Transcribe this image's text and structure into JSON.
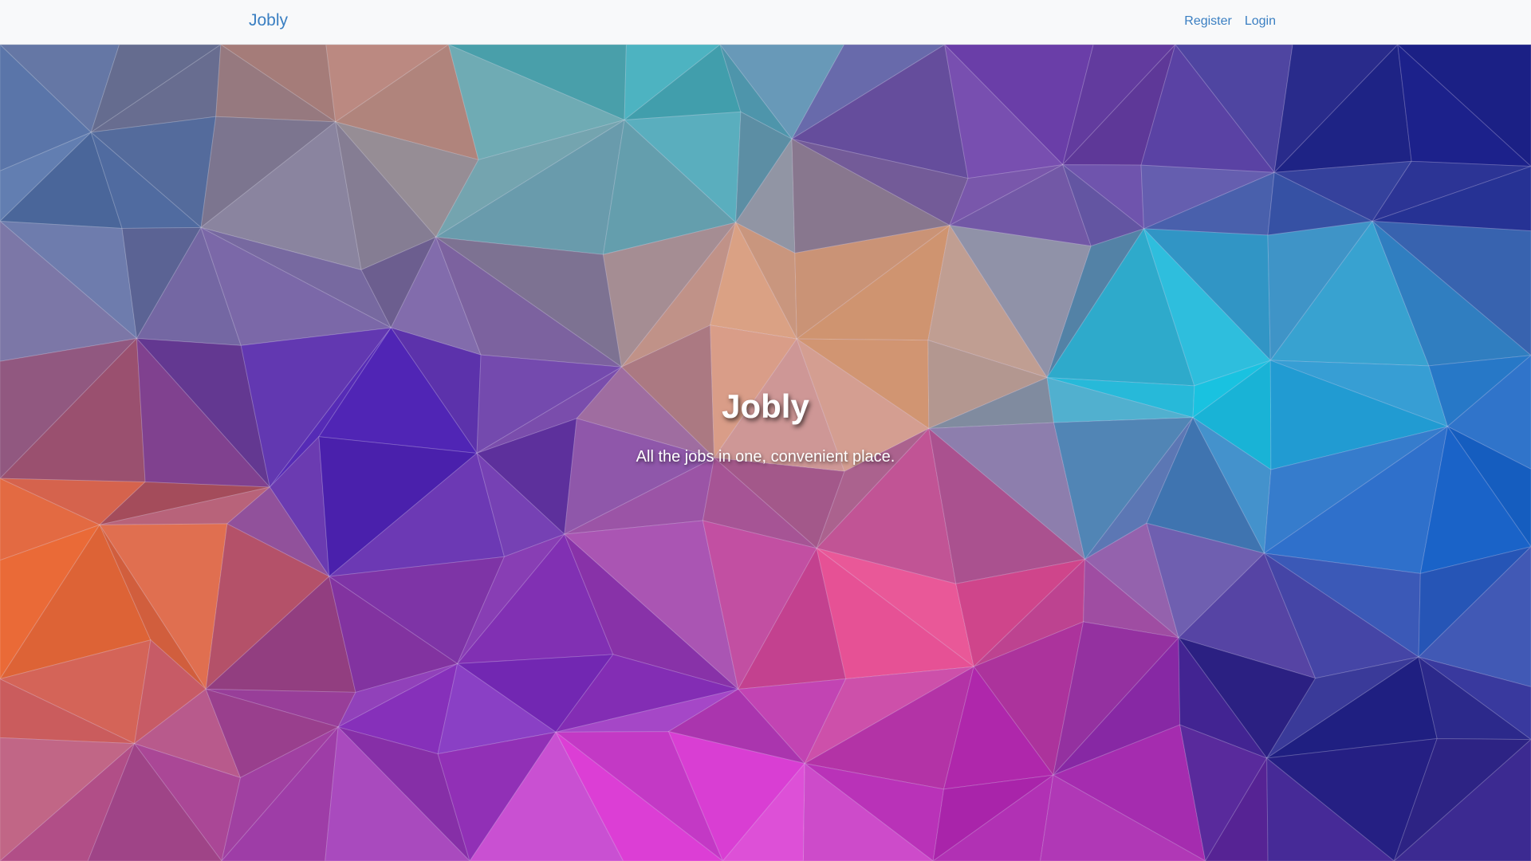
{
  "navbar": {
    "brand": "Jobly",
    "links": [
      {
        "label": "Register"
      },
      {
        "label": "Login"
      }
    ]
  },
  "hero": {
    "title": "Jobly",
    "tagline": "All the jobs in one, convenient place."
  },
  "background": {
    "style": "low-poly triangle mosaic",
    "colors": {
      "teal": "#3fb7c4",
      "slate_blue": "#4f6fa8",
      "peach": "#f2a978",
      "indigo": "#4a1fb8",
      "purple": "#7a2ac0",
      "magenta": "#e23fd8",
      "orange": "#ec6a35",
      "cyan": "#12c2e0",
      "navy": "#1a1f8a"
    }
  }
}
